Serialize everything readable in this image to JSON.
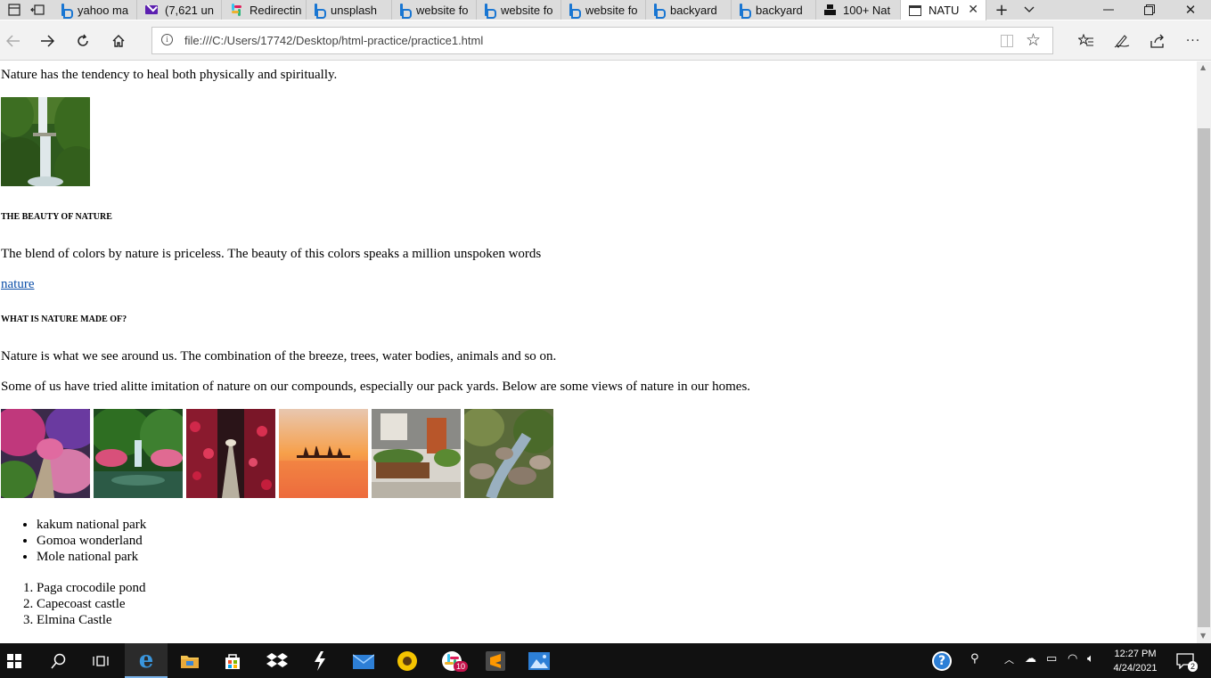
{
  "browser": {
    "tabs": [
      {
        "label": "yahoo ma",
        "icon": "bing-icon"
      },
      {
        "label": "(7,621 un",
        "icon": "yahoo-mail-icon"
      },
      {
        "label": "Redirectin",
        "icon": "slack-icon"
      },
      {
        "label": "unsplash",
        "icon": "bing-icon"
      },
      {
        "label": "website fo",
        "icon": "bing-icon"
      },
      {
        "label": "website fo",
        "icon": "bing-icon"
      },
      {
        "label": "website fo",
        "icon": "bing-icon"
      },
      {
        "label": "backyard",
        "icon": "bing-icon"
      },
      {
        "label": "backyard",
        "icon": "bing-icon"
      },
      {
        "label": "100+ Nat",
        "icon": "unsplash-icon"
      },
      {
        "label": "NATU",
        "icon": "page-icon",
        "active": true
      }
    ],
    "address": "file:///C:/Users/17742/Desktop/html-practice/practice1.html"
  },
  "page": {
    "intro": "Nature has the tendency to heal both physically and spiritually.",
    "heading1": "THE BEAUTY OF NATURE",
    "para1": "The blend of colors by nature is priceless. The beauty of this colors speaks a million unspoken words",
    "link": "nature",
    "heading2": "WHAT IS NATURE MADE OF?",
    "para2": "Nature is what we see around us. The combination of the breeze, trees, water bodies, animals and so on.",
    "para3": "Some of us have tried alitte imitation of nature on our compounds, especially our pack yards. Below are some views of nature in our homes.",
    "bullets": [
      "kakum national park",
      "Gomoa wonderland",
      "Mole national park"
    ],
    "numbered": [
      "Paga crocodile pond",
      "Capecoast castle",
      "Elmina Castle"
    ]
  },
  "taskbar": {
    "time": "12:27 PM",
    "date": "4/24/2021",
    "slack_badge": "10",
    "notification_count": "2"
  },
  "colors": {
    "tab_bar": "#dcdcdc",
    "link": "#0b4ea8",
    "edge_blue": "#1976d2",
    "taskbar": "#111111"
  }
}
